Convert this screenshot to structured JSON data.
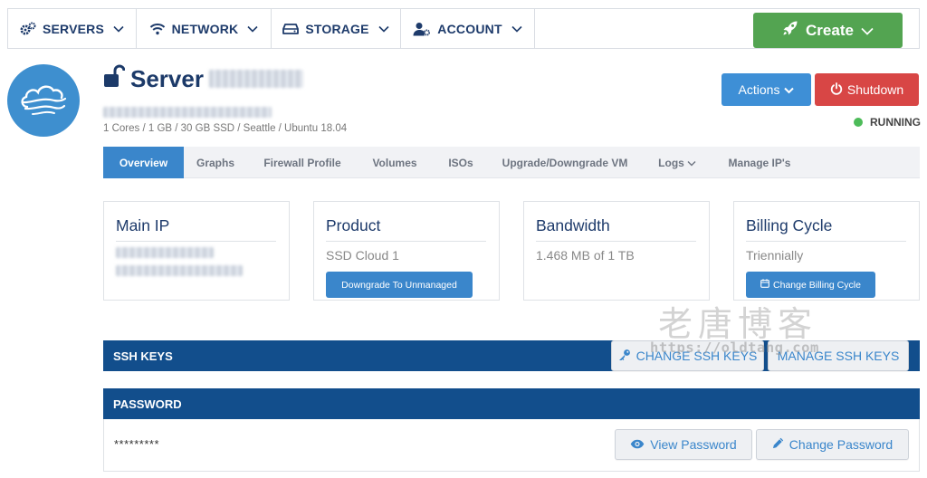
{
  "nav": {
    "items": [
      {
        "label": "SERVERS",
        "icon": "gears-icon"
      },
      {
        "label": "NETWORK",
        "icon": "wifi-icon"
      },
      {
        "label": "STORAGE",
        "icon": "hdd-icon"
      },
      {
        "label": "ACCOUNT",
        "icon": "user-gear-icon"
      }
    ],
    "create_label": "Create"
  },
  "server": {
    "name": "Server",
    "specs": "1 Cores / 1 GB / 30 GB SSD / Seattle / Ubuntu 18.04",
    "status": "RUNNING"
  },
  "header_actions": {
    "actions_label": "Actions",
    "shutdown_label": "Shutdown"
  },
  "tabs": [
    {
      "label": "Overview",
      "active": true
    },
    {
      "label": "Graphs"
    },
    {
      "label": "Firewall Profile"
    },
    {
      "label": "Volumes"
    },
    {
      "label": "ISOs"
    },
    {
      "label": "Upgrade/Downgrade VM"
    },
    {
      "label": "Logs"
    },
    {
      "label": "Manage IP's"
    }
  ],
  "cards": {
    "main_ip": {
      "title": "Main IP"
    },
    "product": {
      "title": "Product",
      "value": "SSD Cloud 1",
      "button": "Downgrade To Unmanaged"
    },
    "bandwidth": {
      "title": "Bandwidth",
      "value": "1.468 MB of 1 TB"
    },
    "billing": {
      "title": "Billing Cycle",
      "value": "Triennially",
      "button": "Change Billing Cycle"
    }
  },
  "ssh": {
    "title": "SSH KEYS",
    "change_label": "CHANGE SSH KEYS",
    "manage_label": "MANAGE SSH KEYS"
  },
  "password": {
    "title": "PASSWORD",
    "masked": "*********",
    "view_label": "View Password",
    "change_label": "Change Password"
  },
  "watermark": {
    "text": "老唐博客",
    "url": "https://oldtang.com"
  },
  "colors": {
    "navy": "#1e3b6b",
    "primary": "#3a86cb",
    "create": "#53a451",
    "danger": "#d84645",
    "bar": "#124e8c",
    "running": "#4dbb59"
  }
}
